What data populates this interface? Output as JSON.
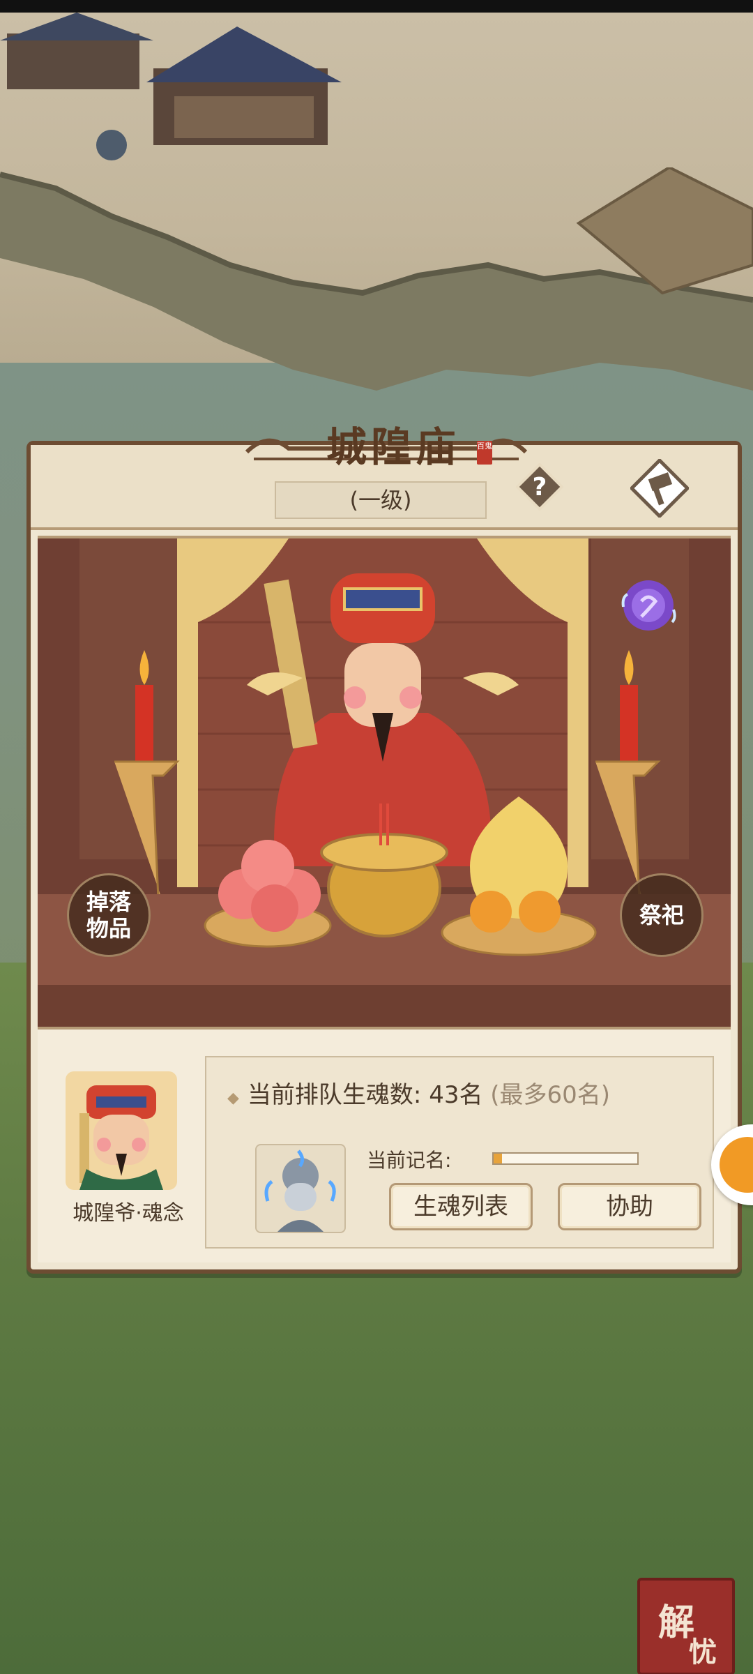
{
  "temple": {
    "title": "城隍庙",
    "seal_text": "百鬼",
    "level": "(一级)"
  },
  "scene": {
    "drop_items_label_line1": "掉落",
    "drop_items_label_line2": "物品",
    "sacrifice_label": "祭祀"
  },
  "info": {
    "portrait_label": "城隍爷·魂念",
    "queue_label": "当前排队生魂数:",
    "queue_count": "43名",
    "queue_max": "(最多60名)",
    "record_label": "当前记名:",
    "record_progress": 0.06,
    "soul_list_button": "生魂列表",
    "assist_button": "协助"
  },
  "corner_badge": {
    "char1": "解",
    "char2": "忧"
  },
  "icons": [
    "help-icon",
    "hammer-icon",
    "soul-orb-icon",
    "ghost-avatar-icon",
    "side-float-icon"
  ]
}
